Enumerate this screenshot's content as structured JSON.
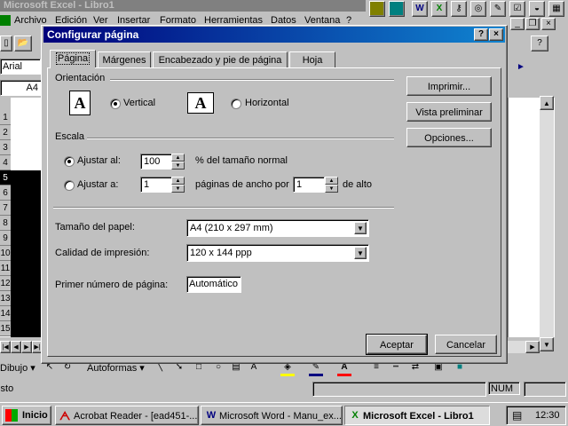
{
  "app": {
    "title": "Microsoft Excel - Libro1",
    "menu": [
      "Archivo",
      "Edición",
      "Ver",
      "Insertar",
      "Formato",
      "Herramientas",
      "Datos",
      "Ventana",
      "?"
    ],
    "font_name": "Arial",
    "cell_ref": "A4",
    "row_numbers": [
      "1",
      "2",
      "3",
      "4",
      "5",
      "6",
      "7",
      "8",
      "9",
      "10",
      "11",
      "12",
      "13",
      "14",
      "15"
    ],
    "drawing_label": "Dibujo",
    "autoshapes_label": "Autoformas",
    "status_text": "Listo",
    "num_indicator": "NUM"
  },
  "dialog": {
    "title": "Configurar página",
    "tabs": [
      "Página",
      "Márgenes",
      "Encabezado y pie de página",
      "Hoja"
    ],
    "active_tab": "Página",
    "orientation": {
      "label": "Orientación",
      "vertical": "Vertical",
      "horizontal": "Horizontal",
      "selected": "Vertical"
    },
    "scale": {
      "label": "Escala",
      "adjust_to_label": "Ajustar al:",
      "adjust_to_value": "100",
      "adjust_to_suffix": "% del tamaño normal",
      "fit_to_label": "Ajustar a:",
      "fit_wide_value": "1",
      "fit_wide_suffix": "páginas de ancho por",
      "fit_tall_value": "1",
      "fit_tall_suffix": "de alto",
      "selected": "Ajustar al:"
    },
    "paper_size": {
      "label": "Tamaño del papel:",
      "value": "A4 (210 x 297 mm)"
    },
    "print_quality": {
      "label": "Calidad de impresión:",
      "value": "120 x 144 ppp"
    },
    "first_page": {
      "label": "Primer número de página:",
      "value": "Automático"
    },
    "buttons": {
      "print": "Imprimir...",
      "preview": "Vista preliminar",
      "options": "Opciones...",
      "ok": "Aceptar",
      "cancel": "Cancelar"
    },
    "help_glyph": "?",
    "close_glyph": "×"
  },
  "taskbar": {
    "start": "Inicio",
    "items": [
      {
        "label": "Acrobat Reader - [ead451-...",
        "icon": "acrobat-icon"
      },
      {
        "label": "Microsoft Word - Manu_ex...",
        "icon": "word-icon"
      },
      {
        "label": "Microsoft Excel - Libro1",
        "icon": "excel-icon"
      }
    ],
    "clock": "12:30"
  },
  "colors": {
    "title_active": "#00007b",
    "face": "#c0c0c0",
    "shadow": "#808080"
  }
}
